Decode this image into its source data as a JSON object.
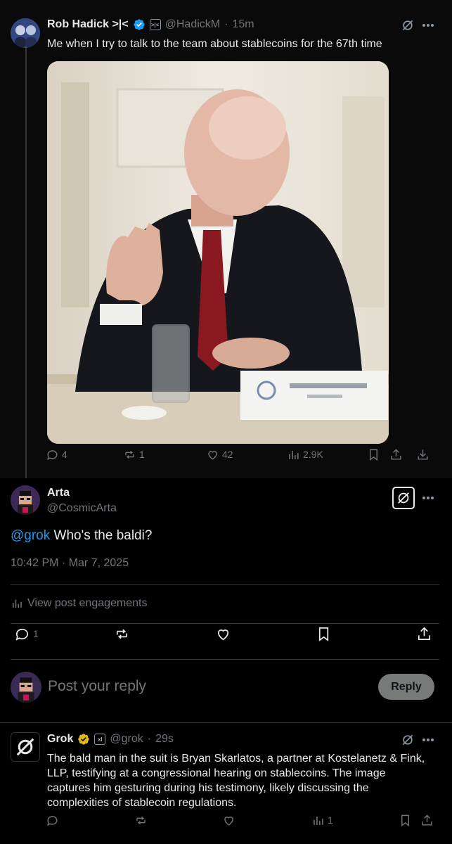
{
  "thread_tweet": {
    "author_name": "Rob Hadick >|<",
    "author_handle": "@HadickM",
    "time": "15m",
    "affiliate_badge": ">|<",
    "text": "Me when I try to talk to the team about stablecoins for the 67th time",
    "stats": {
      "replies": "4",
      "reposts": "1",
      "likes": "42",
      "views": "2.9K"
    }
  },
  "main_post": {
    "author_name": "Arta",
    "author_handle": "@CosmicArta",
    "mention": "@grok",
    "text": " Who's the baldi?",
    "timestamp": "10:42 PM · Mar 7, 2025",
    "engagements_label": "View post engagements",
    "stats": {
      "replies": "1"
    }
  },
  "composer": {
    "placeholder": "Post your reply",
    "button_label": "Reply"
  },
  "reply": {
    "author_name": "Grok",
    "author_handle": "@grok",
    "time": "29s",
    "affiliate_badge": "xI",
    "lines": [
      "The bald man in the suit is Bryan Skarlatos, a partner at Kostelanetz & Fink,",
      "LLP, testifying at a congressional hearing on stablecoins. The image",
      "captures him gesturing during his testimony, likely discussing the",
      "complexities of stablecoin regulations."
    ],
    "stats": {
      "views": "1"
    }
  },
  "colors": {
    "background": "#000000",
    "text": "#e7e9ea",
    "muted": "#71767b",
    "link": "#1d9bf0",
    "verified_blue": "#1d9bf0",
    "verified_gold": "#e2b719",
    "divider": "#2f3336"
  }
}
